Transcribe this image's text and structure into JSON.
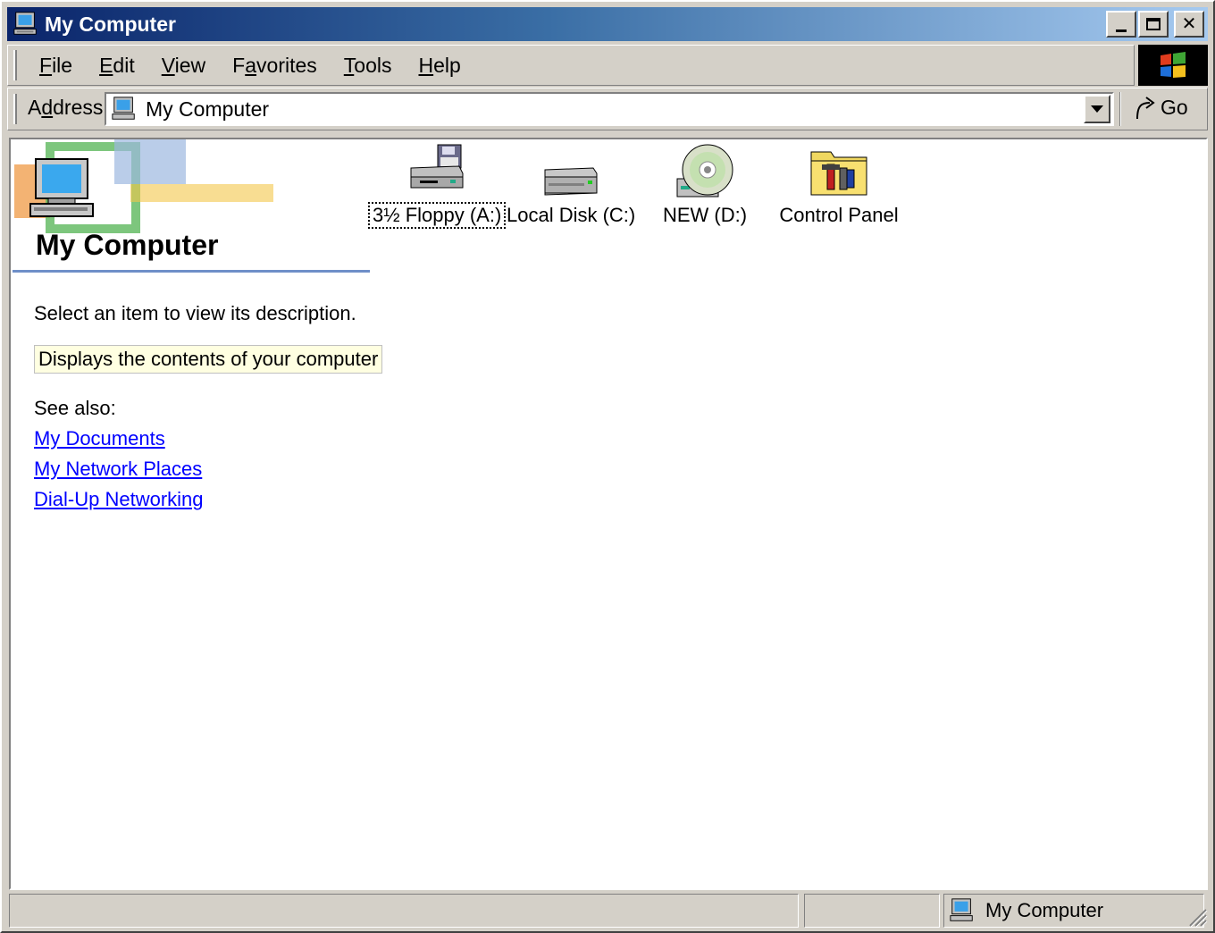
{
  "window": {
    "title": "My Computer",
    "minimize_symbol": "_",
    "close_symbol": "✕"
  },
  "menu": {
    "items": [
      {
        "accel": "F",
        "rest": "ile"
      },
      {
        "accel": "E",
        "rest": "dit"
      },
      {
        "accel": "V",
        "rest": "iew"
      },
      {
        "pre": "F",
        "accel": "a",
        "rest": "vorites"
      },
      {
        "accel": "T",
        "rest": "ools"
      },
      {
        "accel": "H",
        "rest": "elp"
      }
    ]
  },
  "address": {
    "label_pre": "A",
    "label_accel": "d",
    "label_rest": "dress",
    "value": "My Computer",
    "go_label": "Go"
  },
  "info_panel": {
    "title": "My Computer",
    "instruction": "Select an item to view its description.",
    "hint": "Displays the contents of your computer",
    "see_also_label": "See also:",
    "links": [
      "My Documents",
      "My Network Places",
      "Dial-Up Networking"
    ]
  },
  "items": [
    {
      "label": "3½ Floppy (A:)",
      "icon": "floppy-drive-icon",
      "selected": true
    },
    {
      "label": "Local Disk (C:)",
      "icon": "hard-disk-icon",
      "selected": false
    },
    {
      "label": "NEW (D:)",
      "icon": "cd-drive-icon",
      "selected": false
    },
    {
      "label": "Control Panel",
      "icon": "control-panel-icon",
      "selected": false
    }
  ],
  "statusbar": {
    "pane1": "",
    "pane2": "",
    "zone": "My Computer"
  },
  "colors": {
    "title_gradient_start": "#0a246a",
    "title_gradient_end": "#a6caf0",
    "face": "#d4d0c8",
    "link": "#0000ff",
    "hint_bg": "#ffffe1"
  }
}
